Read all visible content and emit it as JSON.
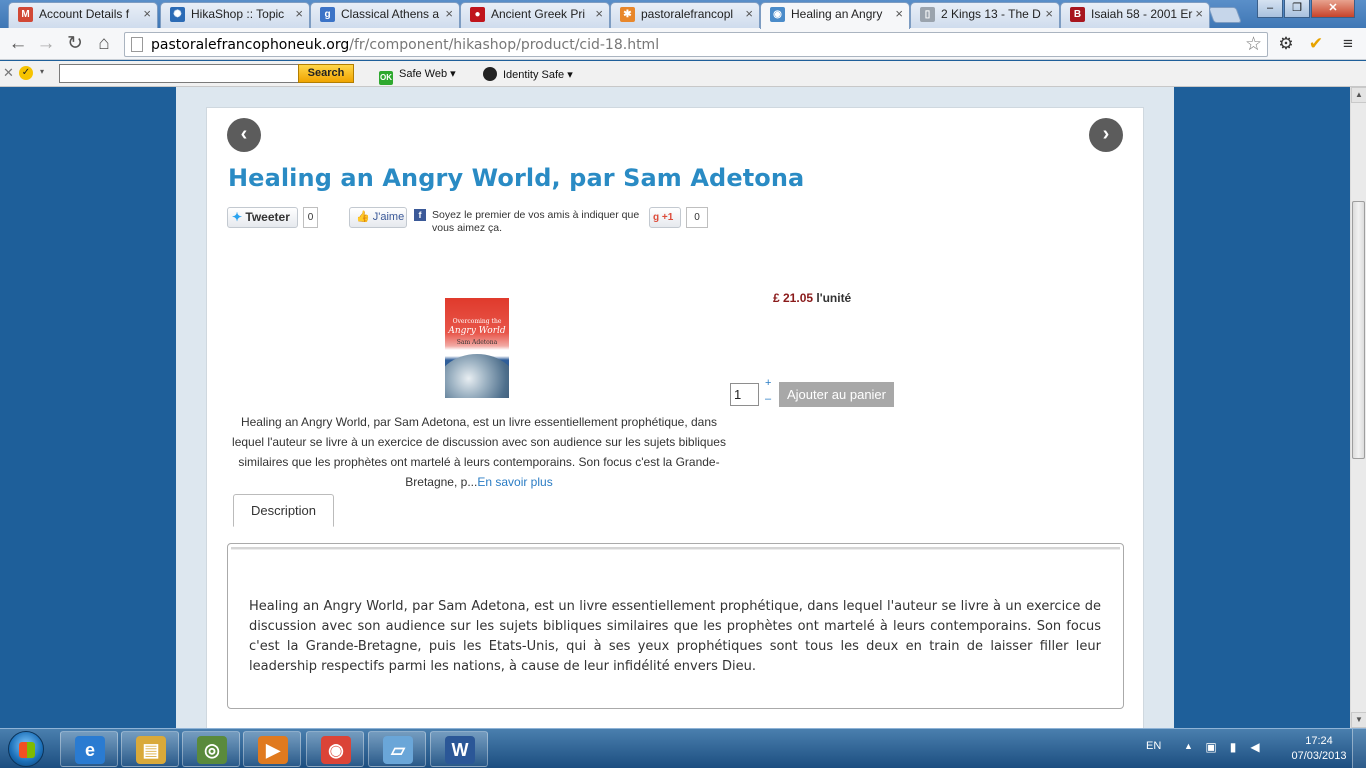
{
  "browser": {
    "tabs": [
      {
        "title": "Account Details f",
        "icon": "gmail-icon",
        "color": "#d14836",
        "glyph": "M"
      },
      {
        "title": "HikaShop :: Topic",
        "icon": "hikashop-icon",
        "color": "#2b6bb5",
        "glyph": "✺"
      },
      {
        "title": "Classical Athens a",
        "icon": "google-icon",
        "color": "#3b73c7",
        "glyph": "g"
      },
      {
        "title": "Ancient Greek Pri",
        "icon": "red-circle-icon",
        "color": "#c0141b",
        "glyph": "●"
      },
      {
        "title": "pastoralefrancopl",
        "icon": "joomla-icon",
        "color": "#e8872b",
        "glyph": "✱"
      },
      {
        "title": "Healing an Angry",
        "icon": "globe-icon",
        "color": "#4a8bc9",
        "glyph": "◉"
      },
      {
        "title": "2 Kings 13 - The D",
        "icon": "page-icon",
        "color": "#9aa3ad",
        "glyph": "▯"
      },
      {
        "title": "Isaiah 58 - 2001 Er",
        "icon": "bible-icon",
        "color": "#a8161e",
        "glyph": "B"
      }
    ],
    "active_tab": 5,
    "url_domain": "pastoralefrancophoneuk.org",
    "url_path": "/fr/component/hikashop/product/cid-18.html",
    "norton": {
      "search_label": "Search",
      "safe_web": "Safe Web ▾",
      "identity_safe": "Identity Safe ▾",
      "safe_web_badge": "OK"
    }
  },
  "product": {
    "title": "Healing an Angry World, par Sam Adetona",
    "tweet_label": "Tweeter",
    "tweet_count": "0",
    "like_label": "J'aime",
    "fb_text": "Soyez le premier de vos amis à indiquer que vous aimez ça.",
    "gplus_label": "+1",
    "gplus_count": "0",
    "cover": {
      "line1": "Overcoming the",
      "line2": "Angry World",
      "line3": "Sam Adetona"
    },
    "price_amount": "£ 21.05",
    "price_unit": " l'unité",
    "qty": "1",
    "qty_plus": "+",
    "qty_minus": "–",
    "add_to_cart": "Ajouter au panier",
    "short_desc": "Healing an Angry World, par Sam Adetona, est un livre essentiellement prophétique, dans lequel l'auteur se livre à un exercice de discussion avec son audience sur les sujets bibliques similaires que les prophètes ont martelé à leurs contemporains. Son focus c'est la Grande-Bretagne, p...",
    "read_more": "En savoir plus",
    "tab_description": "Description",
    "description": "Healing an Angry World, par Sam Adetona, est un livre essentiellement prophétique, dans lequel l'auteur se livre à un exercice de discussion avec son audience sur les sujets bibliques similaires que les prophètes ont martelé à leurs contemporains. Son focus c'est la Grande-Bretagne, puis les Etats-Unis, qui à ses yeux prophétiques sont tous les deux en train de laisser filler leur leadership respectifs parmi les nations, à cause de leur infidélité envers Dieu."
  },
  "taskbar": {
    "apps": [
      {
        "name": "ie-icon",
        "glyph": "e",
        "color": "#2a7bd1"
      },
      {
        "name": "explorer-icon",
        "glyph": "▤",
        "color": "#d9a93a"
      },
      {
        "name": "media-center-icon",
        "glyph": "◎",
        "color": "#5a8a3c"
      },
      {
        "name": "media-player-icon",
        "glyph": "▶",
        "color": "#e07a1f"
      },
      {
        "name": "chrome-icon",
        "glyph": "◉",
        "color": "#db4437"
      },
      {
        "name": "notepad-icon",
        "glyph": "▱",
        "color": "#6aa6d8"
      },
      {
        "name": "word-icon",
        "glyph": "W",
        "color": "#2b5797"
      }
    ],
    "language": "EN",
    "time": "17:24",
    "date": "07/03/2013"
  }
}
